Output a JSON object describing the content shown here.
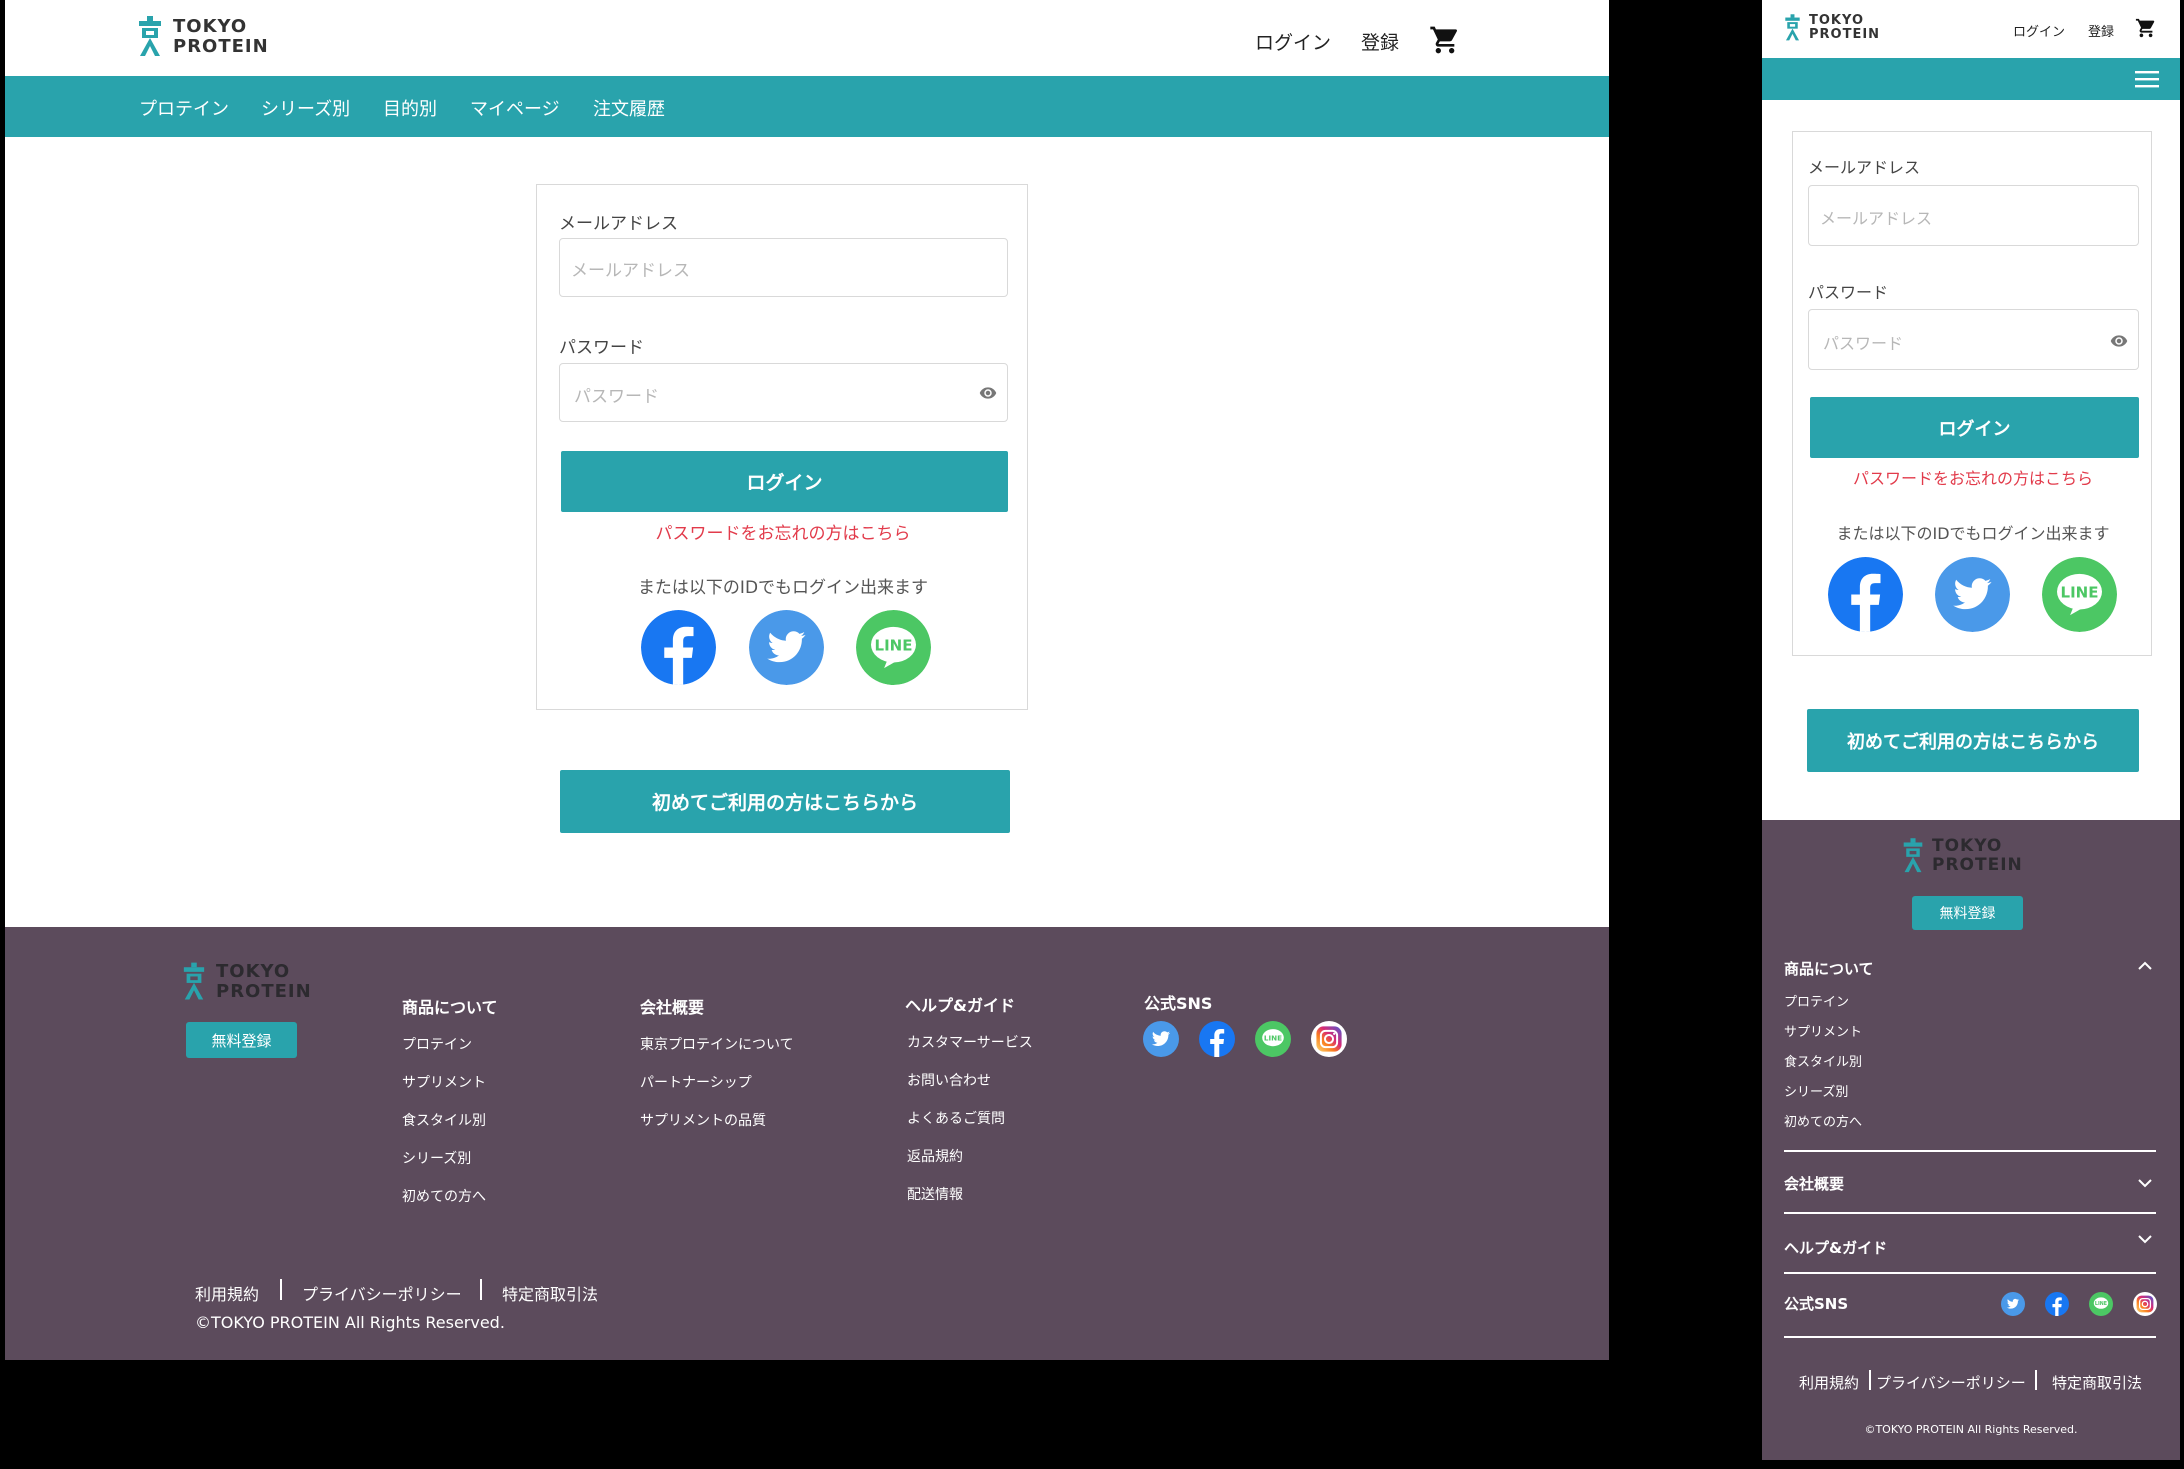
{
  "brand": {
    "line1": "TOKYO",
    "line2": "PROTEIN"
  },
  "header": {
    "login": "ログイン",
    "register": "登録"
  },
  "nav": [
    "プロテイン",
    "シリーズ別",
    "目的別",
    "マイページ",
    "注文履歴"
  ],
  "form": {
    "email_label": "メールアドレス",
    "email_placeholder": "メールアドレス",
    "password_label": "パスワード",
    "password_placeholder": "パスワード",
    "login_button": "ログイン",
    "forgot": "パスワードをお忘れの方はこちら",
    "or_text": "または以下のIDでもログイン出来ます"
  },
  "first_time_button": "初めてご利用の方はこちらから",
  "footer": {
    "signup_button": "無料登録",
    "sections": [
      {
        "title": "商品について",
        "links": [
          "プロテイン",
          "サプリメント",
          "食スタイル別",
          "シリーズ別",
          "初めての方へ"
        ]
      },
      {
        "title": "会社概要",
        "links": [
          "東京プロテインについて",
          "パートナーシップ",
          "サプリメントの品質"
        ]
      },
      {
        "title": "ヘルプ&ガイド",
        "links": [
          "カスタマーサービス",
          "お問い合わせ",
          "よくあるご質問",
          "返品規約",
          "配送情報"
        ]
      },
      {
        "title": "公式SNS",
        "links": []
      }
    ],
    "legal": [
      "利用規約",
      "プライバシーポリシー",
      "特定商取引法"
    ],
    "copyright": "©TOKYO PROTEIN All Rights Reserved."
  },
  "colors": {
    "accent": "#29a3ac",
    "footer": "#5c4b5c",
    "error": "#e23b4b",
    "facebook": "#1877f2",
    "twitter": "#4a99e9",
    "line": "#4cc764"
  }
}
